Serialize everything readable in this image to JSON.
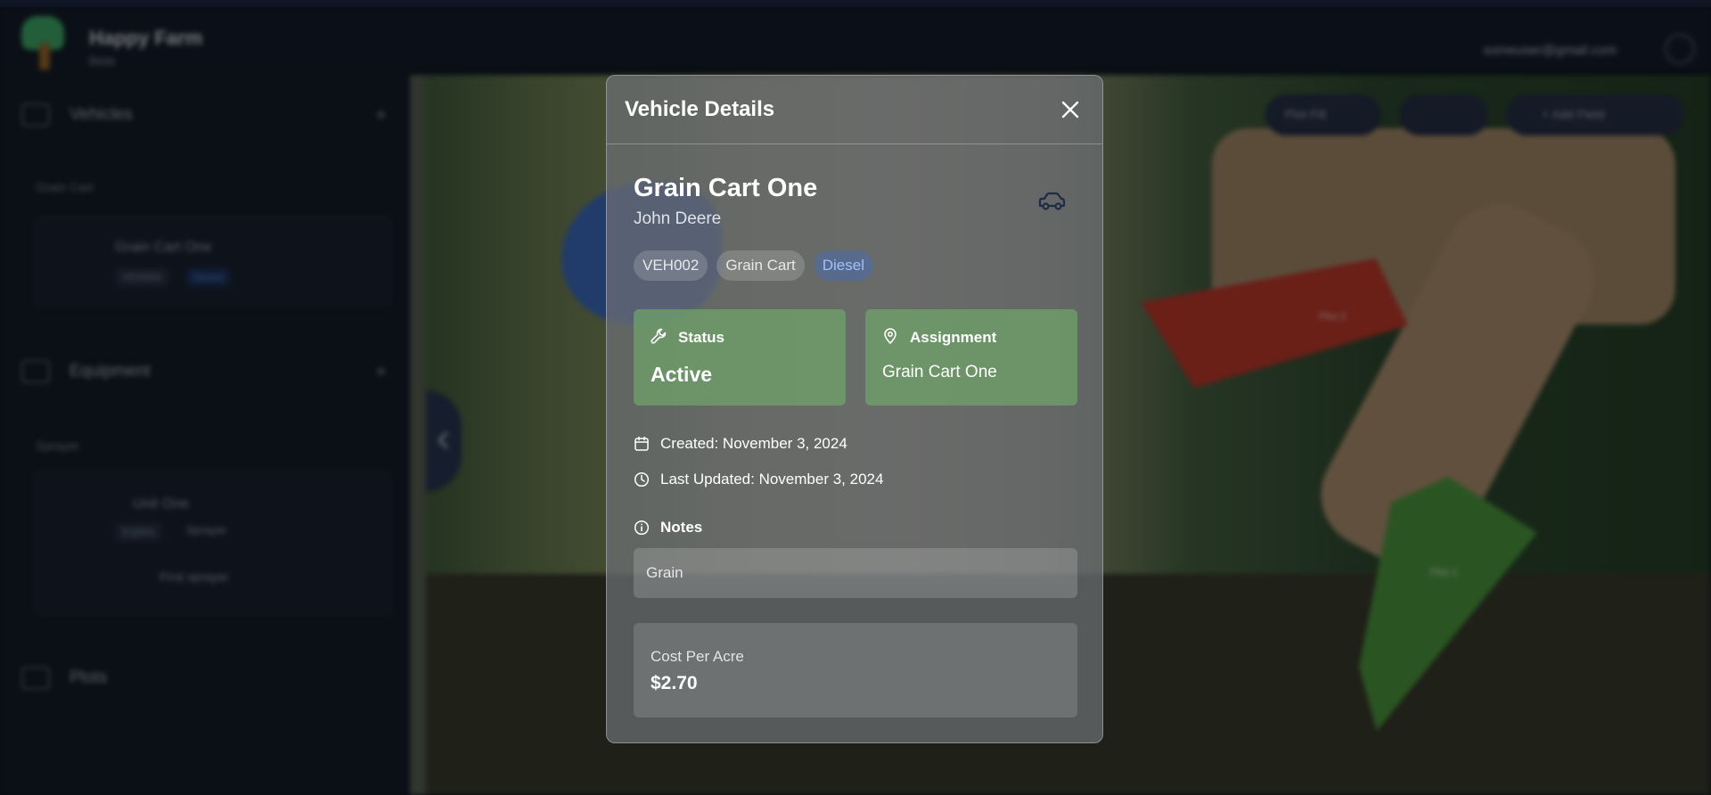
{
  "app": {
    "title": "Happy Farm",
    "subtitle": "Beta",
    "user_email": "someuser@gmail.com"
  },
  "sidebar": {
    "vehicles_label": "Vehicles",
    "vehicles_group": "Grain Cart",
    "vehicle_card": {
      "name": "Grain Cart One",
      "id": "VEH002",
      "fuel": "Diesel"
    },
    "equipment_label": "Equipment",
    "equipment_group": "Sprayer",
    "equipment_card": {
      "name": "Unit One",
      "id": "EQ001",
      "type": "Sprayer",
      "note": "First sprayer"
    },
    "plots_label": "Plots"
  },
  "map": {
    "plot_fill_label": "Plot Fill",
    "add_field_label": "+ Add Field",
    "plot_labels": [
      "Plot 2",
      "Plot 1"
    ]
  },
  "modal": {
    "title": "Vehicle Details",
    "vehicle_name": "Grain Cart One",
    "make": "John Deere",
    "chips": {
      "id": "VEH002",
      "type": "Grain Cart",
      "fuel": "Diesel"
    },
    "status_label": "Status",
    "status_value": "Active",
    "assignment_label": "Assignment",
    "assignment_value": "Grain Cart One",
    "created": "Created: November 3, 2024",
    "updated": "Last Updated: November 3, 2024",
    "notes_label": "Notes",
    "notes_value": "Grain",
    "cost_label": "Cost Per Acre",
    "cost_value": "$2.70"
  },
  "colors": {
    "status_card": "#70a569",
    "plot_red": "#c43a2c",
    "plot_green": "#4f9d3f",
    "fuel_chip_text": "#9fc0ff"
  }
}
